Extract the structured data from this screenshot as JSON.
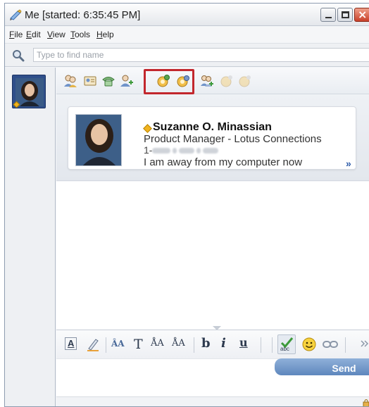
{
  "window": {
    "title": "Me [started: 6:35:45 PM]"
  },
  "menu": {
    "items": [
      "File",
      "Edit",
      "View",
      "Tools",
      "Help"
    ]
  },
  "search": {
    "placeholder": "Type to find name"
  },
  "contact": {
    "name": "Suzanne O. Minassian",
    "job_title": "Product Manager - Lotus Connections",
    "phone_prefix": "1-",
    "status_message": "I am away from my computer now",
    "status": "away",
    "more_label": "»"
  },
  "actions": {
    "icons": [
      "add-contact-icon",
      "business-card-icon",
      "phone-icon",
      "add-person-icon",
      "share-screen-icon",
      "meeting-icon",
      "add-group-icon",
      "disabled-tool-icon",
      "disabled-tool-2-icon"
    ],
    "highlighted": [
      "share-screen-icon",
      "meeting-icon"
    ]
  },
  "formatting": {
    "font_color": "A",
    "text_size": "T",
    "bold": "b",
    "italic": "i",
    "underline": "u",
    "spell_label": "abc"
  },
  "compose": {
    "send_label": "Send"
  },
  "colors": {
    "highlight": "#c2272d",
    "accent": "#5e87bd",
    "status_away": "#f1b31f"
  }
}
